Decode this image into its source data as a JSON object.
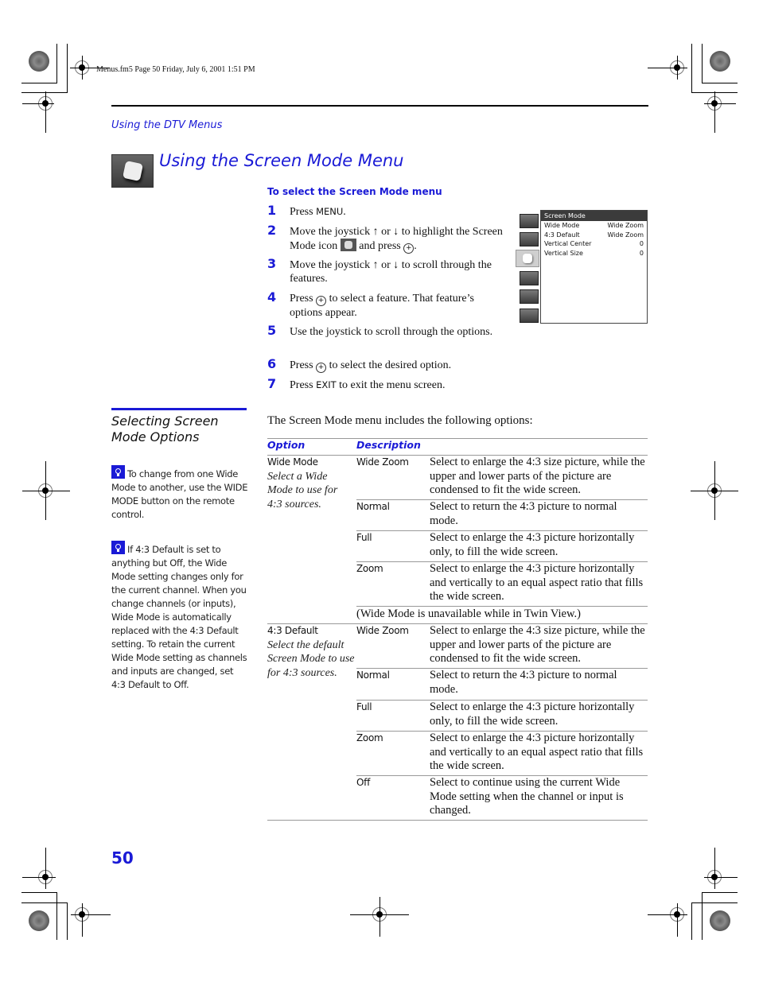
{
  "print_header": "Menus.fm5  Page 50  Friday, July 6, 2001  1:51 PM",
  "running_head": "Using the DTV Menus",
  "title": "Using the Screen Mode Menu",
  "procedure": {
    "heading": "To select the Screen Mode menu",
    "steps": [
      {
        "num": "1",
        "parts": [
          "Press ",
          "MENU",
          "."
        ]
      },
      {
        "num": "2",
        "parts": [
          "Move the joystick ↑ or ↓ to highlight the Screen Mode icon ",
          " and press ",
          "."
        ]
      },
      {
        "num": "3",
        "text": "Move the joystick ↑ or ↓ to scroll through the features."
      },
      {
        "num": "4",
        "parts": [
          "Press ",
          " to select a feature. That feature’s options appear."
        ]
      },
      {
        "num": "5",
        "text": "Use the joystick to scroll through the options."
      },
      {
        "num": "6",
        "parts": [
          "Press ",
          " to select the desired option."
        ]
      },
      {
        "num": "7",
        "parts": [
          "Press ",
          "EXIT",
          " to exit the menu screen."
        ]
      }
    ]
  },
  "menu_screenshot": {
    "title": "Screen Mode",
    "rows": [
      {
        "label": "Wide Mode",
        "value": "Wide Zoom"
      },
      {
        "label": "4:3 Default",
        "value": "Wide Zoom"
      },
      {
        "label": "Vertical Center",
        "value": "0"
      },
      {
        "label": "Vertical Size",
        "value": "0"
      }
    ],
    "icons": [
      "video-icon",
      "audio-icon",
      "screen-mode-icon",
      "channel-icon",
      "parental-icon",
      "setup-icon"
    ],
    "selected_icon": "screen-mode-icon"
  },
  "sidebar": {
    "heading": "Selecting Screen Mode Options",
    "tips": [
      "To change from one Wide Mode to another, use the WIDE MODE button on the remote control.",
      "If 4:3 Default is set to anything but Off, the Wide Mode setting changes only for the current channel. When you change channels (or inputs), Wide Mode is automatically replaced with the 4:3 Default setting. To retain the current Wide Mode setting as channels and inputs are changed, set 4:3 Default to Off."
    ]
  },
  "intro": "The Screen Mode menu includes the following options:",
  "table": {
    "headers": [
      "Option",
      "Description"
    ],
    "groups": [
      {
        "option": "Wide Mode",
        "note": "Select a Wide Mode to use for 4:3 sources.",
        "rows": [
          {
            "value": "Wide Zoom",
            "desc": "Select to enlarge the 4:3 size picture, while the upper and lower parts of the picture are condensed to fit the wide screen."
          },
          {
            "value": "Normal",
            "desc": "Select to return the 4:3 picture to normal mode."
          },
          {
            "value": "Full",
            "desc": "Select to enlarge the 4:3 picture horizontally only, to fill the wide screen."
          },
          {
            "value": "Zoom",
            "desc": "Select to enlarge the 4:3 picture horizontally and vertically to an equal aspect ratio that fills the wide screen."
          }
        ],
        "footnote": "(Wide Mode is unavailable while in Twin View.)"
      },
      {
        "option": "4:3 Default",
        "note": "Select the default Screen Mode to use for 4:3 sources.",
        "rows": [
          {
            "value": "Wide Zoom",
            "desc": "Select to enlarge the 4:3 size picture, while the upper and lower parts of the picture are condensed to fit the wide screen."
          },
          {
            "value": "Normal",
            "desc": "Select to return the 4:3 picture to normal mode."
          },
          {
            "value": "Full",
            "desc": "Select to enlarge the 4:3 picture horizontally only, to fill the wide screen."
          },
          {
            "value": "Zoom",
            "desc": "Select to enlarge the 4:3 picture horizontally and vertically to an equal aspect ratio that fills the wide screen."
          },
          {
            "value": "Off",
            "desc": "Select to continue using the current Wide Mode setting when the channel or input is changed."
          }
        ]
      }
    ]
  },
  "page_number": "50",
  "colors": {
    "accent": "#1a1ad6",
    "rule": "#999999"
  }
}
